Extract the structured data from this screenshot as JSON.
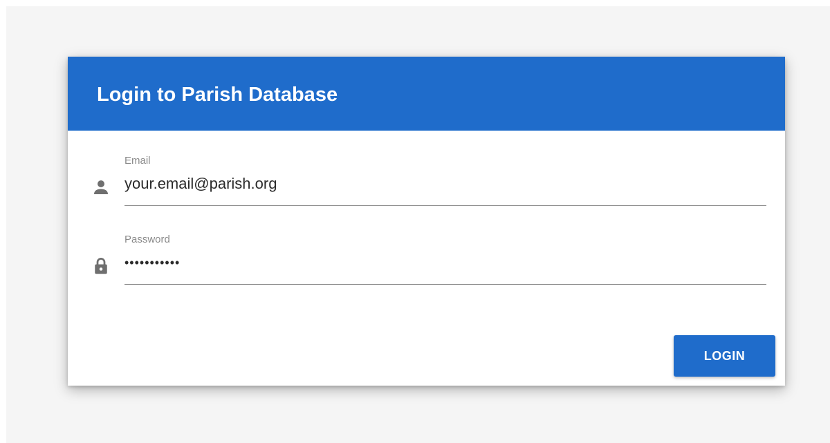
{
  "login_form": {
    "title": "Login to Parish Database",
    "email": {
      "label": "Email",
      "value": "your.email@parish.org",
      "icon": "person-icon"
    },
    "password": {
      "label": "Password",
      "value": "•••••••••••",
      "icon": "lock-icon"
    },
    "submit_label": "LOGIN"
  },
  "colors": {
    "primary": "#1f6ccb",
    "page_background": "#f5f5f5",
    "card_background": "#ffffff",
    "label_text": "#8a8a8a",
    "input_text": "#2b2b2b",
    "icon": "#6f6f6f",
    "underline": "#8c8c8c"
  }
}
